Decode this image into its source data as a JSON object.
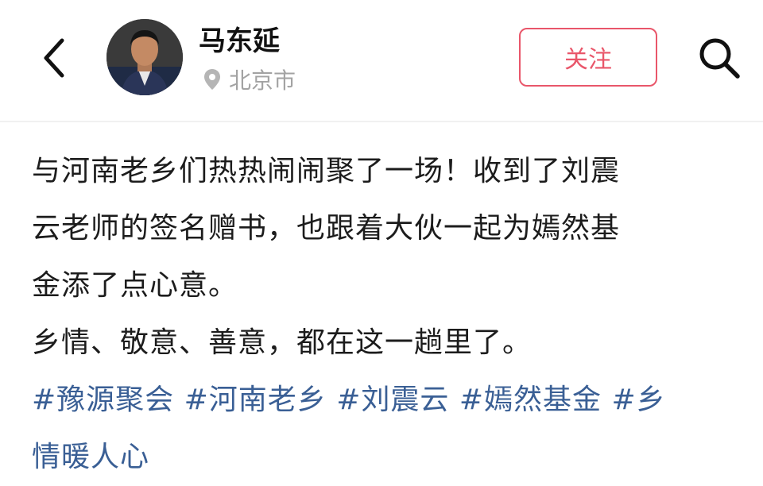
{
  "header": {
    "back_icon": "chevron-left-icon",
    "user_name": "马东延",
    "location_icon": "location-pin-icon",
    "location": "北京市",
    "follow_label": "关注",
    "search_icon": "search-icon"
  },
  "post": {
    "lines": [
      "与河南老乡们热热闹闹聚了一场！收到了刘震",
      "云老师的签名赠书，也跟着大伙一起为嫣然基",
      "金添了点心意。",
      "乡情、敬意、善意，都在这一趟里了。"
    ],
    "tags": [
      "#豫源聚会",
      "#河南老乡",
      "#刘震云",
      "#嫣然基金",
      "#乡",
      "情暖人心"
    ]
  },
  "colors": {
    "follow": "#e9566a",
    "tag": "#3a5f95",
    "location": "#a3a3a3"
  }
}
